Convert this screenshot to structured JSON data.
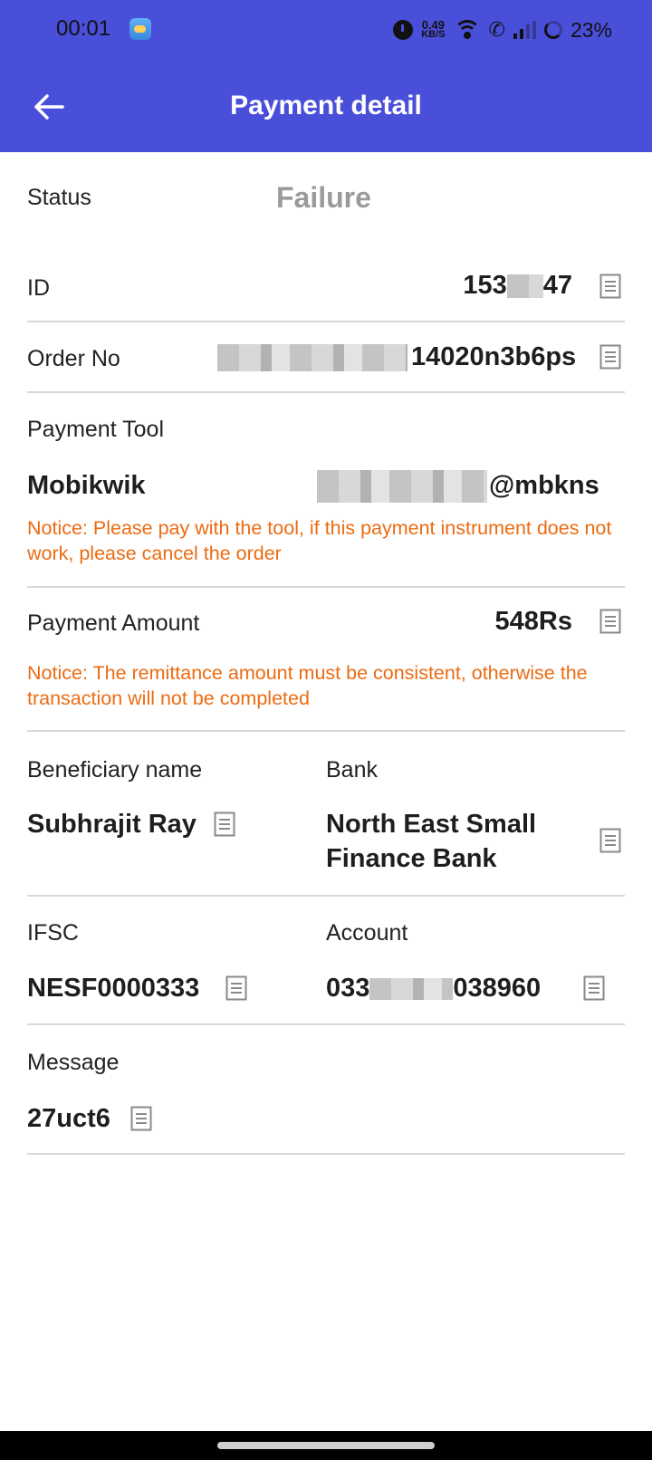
{
  "status_bar": {
    "time": "00:01",
    "speed_value": "0.49",
    "speed_unit": "KB/S",
    "battery": "23%"
  },
  "header": {
    "title": "Payment detail",
    "background": "#4a4fd9"
  },
  "status": {
    "label": "Status",
    "value": "Failure"
  },
  "id": {
    "label": "ID",
    "prefix": "153",
    "suffix": "47"
  },
  "order": {
    "label": "Order No",
    "suffix": "14020n3b6ps"
  },
  "payment_tool": {
    "label": "Payment Tool",
    "name": "Mobikwik",
    "handle_suffix": "@mbkns",
    "notice": "Notice: Please pay with the tool, if this payment instrument does not work, please cancel the order"
  },
  "payment_amount": {
    "label": "Payment Amount",
    "value": "548Rs",
    "notice": "Notice: The remittance amount must be consistent, otherwise the transaction will not be completed"
  },
  "beneficiary": {
    "label": "Beneficiary name",
    "value": "Subhrajit Ray"
  },
  "bank": {
    "label": "Bank",
    "line1": "North East Small",
    "line2": "Finance Bank"
  },
  "ifsc": {
    "label": "IFSC",
    "value": "NESF0000333"
  },
  "account": {
    "label": "Account",
    "prefix": "033",
    "suffix": "038960"
  },
  "message": {
    "label": "Message",
    "value": "27uct6"
  },
  "colors": {
    "accent": "#4a4fd9",
    "notice": "#ec6b12",
    "status_failure": "#9a9a9a"
  }
}
